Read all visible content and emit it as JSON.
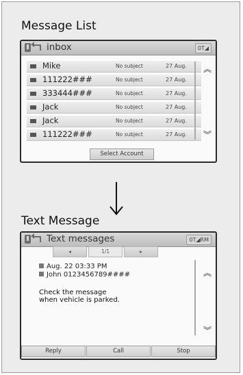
{
  "message_list": {
    "section_title": "Message List",
    "window_title": "inbox",
    "status": "0T◢",
    "rows": [
      {
        "name": "Mike",
        "subject": "No subject",
        "date": "27 Aug."
      },
      {
        "name": "111222###",
        "subject": "No subject",
        "date": "27 Aug."
      },
      {
        "name": "333444###",
        "subject": "No subject",
        "date": "27 Aug."
      },
      {
        "name": "Jack",
        "subject": "No subject",
        "date": "27 Aug."
      },
      {
        "name": "Jack",
        "subject": "No subject",
        "date": "27 Aug."
      },
      {
        "name": "111222###",
        "subject": "No subject",
        "date": "27 Aug."
      }
    ],
    "footer_button": "Select Account"
  },
  "text_message": {
    "section_title": "Text Message",
    "window_title": "Text messages",
    "status": "0T◢RM",
    "page": "1/1",
    "date_line": "Aug. 22 03:33 PM",
    "from_line": "John 0123456789####",
    "body_line1": "Check the message",
    "body_line2": "when vehicle is parked.",
    "buttons": [
      "Reply",
      "Call",
      "Stop"
    ]
  },
  "icons": {
    "scroll_up": "double-chevron-up",
    "scroll_down": "double-chevron-down",
    "message": "envelope",
    "phone": "phone",
    "back": "back-arrow"
  }
}
